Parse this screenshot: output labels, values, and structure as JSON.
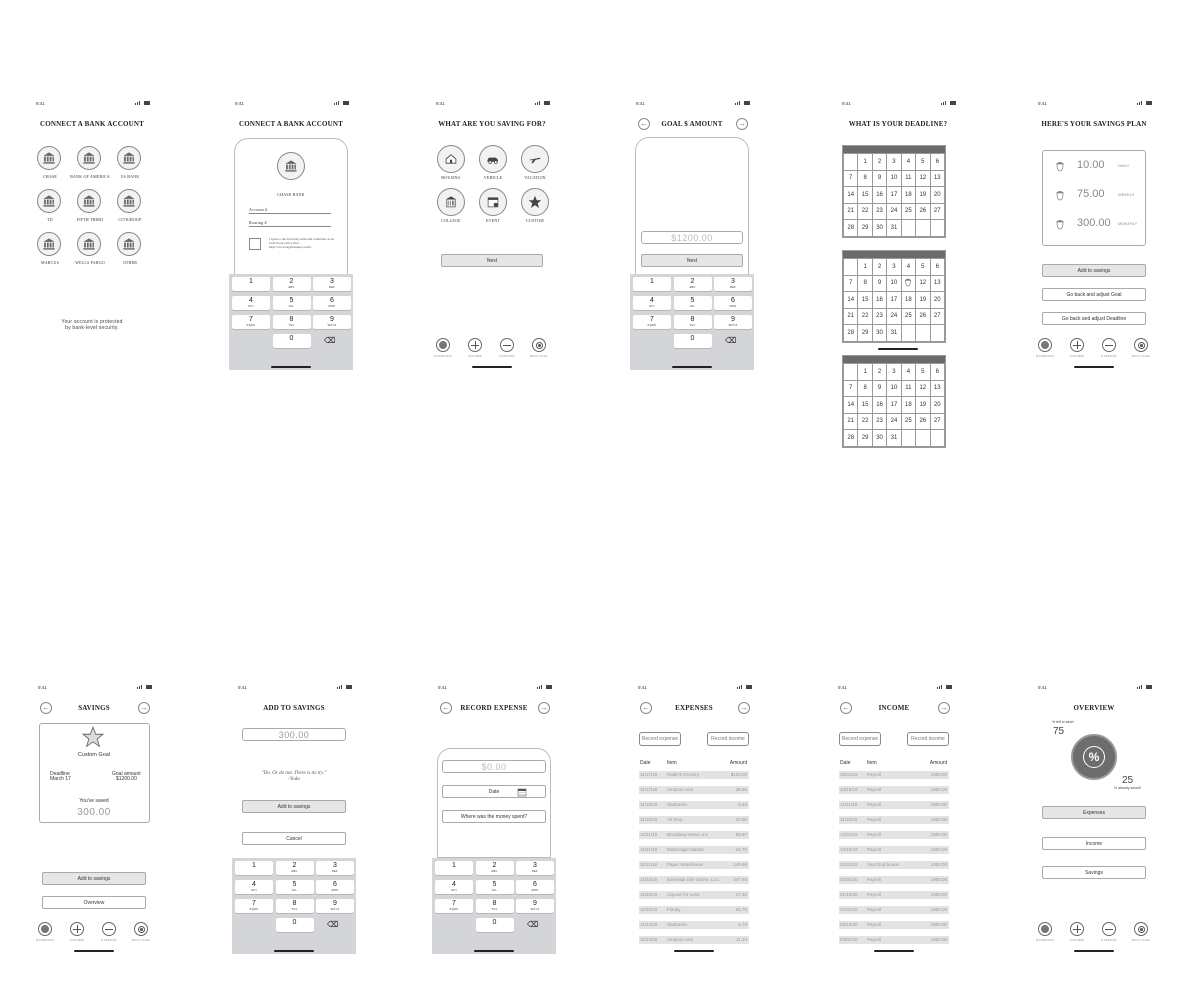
{
  "status_time": "9:41",
  "tabs": [
    "OVERVIEW",
    "INCOME",
    "EXPENSE",
    "NEW GOAL"
  ],
  "screen1": {
    "title": "CONNECT A BANK ACCOUNT",
    "banks": [
      "CHASE",
      "BANK OF AMERICA",
      "US BANK",
      "TD",
      "FIFTH THIRD",
      "CITIGROUP",
      "MARCUS",
      "WELLS FARGO",
      "OTHER"
    ],
    "security_line1": "Your account is protected",
    "security_line2": "by bank-level security."
  },
  "screen2": {
    "title": "CONNECT A BANK ACCOUNT",
    "bank": "CHASE BANK",
    "account_label": "Account #",
    "routing_label": "Routing #",
    "terms": "I agree to the following terms and conditions as set forth in our policy here: https://www.sugarmonkey.com/tc"
  },
  "keypad": [
    {
      "n": "1",
      "l": ""
    },
    {
      "n": "2",
      "l": "ABC"
    },
    {
      "n": "3",
      "l": "DEF"
    },
    {
      "n": "4",
      "l": "GHI"
    },
    {
      "n": "5",
      "l": "JKL"
    },
    {
      "n": "6",
      "l": "MNO"
    },
    {
      "n": "7",
      "l": "PQRS"
    },
    {
      "n": "8",
      "l": "TUV"
    },
    {
      "n": "9",
      "l": "WXYZ"
    },
    {
      "n": "0",
      "l": ""
    }
  ],
  "screen3": {
    "title": "WHAT ARE YOU SAVING FOR?",
    "categories": [
      "HOUSING",
      "VEHICLE",
      "VACATION",
      "COLLEGE",
      "EVENT",
      "CUSTOM"
    ],
    "next": "Next"
  },
  "screen4": {
    "title": "GOAL $ AMOUNT",
    "amount": "$1200.00",
    "next": "Next"
  },
  "screen5": {
    "title": "WHAT IS YOUR DEADLINE?",
    "rows": [
      [
        "",
        "1",
        "2",
        "3",
        "4",
        "5",
        "6"
      ],
      [
        "7",
        "8",
        "9",
        "10",
        "11",
        "12",
        "13"
      ],
      [
        "14",
        "15",
        "16",
        "17",
        "18",
        "19",
        "20"
      ],
      [
        "21",
        "22",
        "23",
        "24",
        "25",
        "26",
        "27"
      ],
      [
        "28",
        "29",
        "30",
        "31",
        "",
        "",
        ""
      ]
    ]
  },
  "screen6": {
    "title": "HERE'S YOUR SAVINGS PLAN",
    "plan": [
      {
        "amount": "10.00",
        "period": "DAILY"
      },
      {
        "amount": "75.00",
        "period": "WEEKLY"
      },
      {
        "amount": "300.00",
        "period": "MONTHLY"
      }
    ],
    "add": "Add to savings",
    "adjust_goal": "Go back and adjust Goal",
    "adjust_deadline": "Go back and adjust Deadline"
  },
  "screen7": {
    "title": "SAVINGS",
    "goal_name": "Custom Goal",
    "deadline_label": "Deadline",
    "deadline_value": "March 17",
    "goal_label": "Goal amount",
    "goal_value": "$1200.00",
    "saved_label": "You've saved",
    "saved_value": "300.00",
    "add": "Add to savings",
    "overview": "Overview"
  },
  "screen8": {
    "title": "ADD TO SAVINGS",
    "amount": "300.00",
    "quote": "\"Do. Or do not. There is no try.\"",
    "author": "-Yoda",
    "add": "Add to savings",
    "cancel": "Cancel"
  },
  "screen9": {
    "title": "RECORD EXPENSE",
    "amount": "$0.00",
    "date": "Date",
    "where": "Where was the money spent?"
  },
  "screen10": {
    "title": "EXPENSES",
    "record_expense": "Record expense",
    "record_income": "Record income",
    "headers": [
      "Date",
      "Item",
      "Amount"
    ],
    "rows": [
      [
        "11/17/19",
        "Ralph's Grocery",
        "$120.00"
      ],
      [
        "11/17/19",
        "Amazon.com",
        "36.65"
      ],
      [
        "11/18/19",
        "Starbucks",
        "5.48"
      ],
      [
        "11/18/19",
        "76 Stop",
        "22.90"
      ],
      [
        "11/21/19",
        "Broadway News, Inc",
        "59.87"
      ],
      [
        "11/21/19",
        "Mississippi Market",
        "44.75"
      ],
      [
        "11/21/19",
        "Paper Warehouse",
        "149.99"
      ],
      [
        "11/22/19",
        "Essential Oils Online, LLC",
        "347.65"
      ],
      [
        "11/23/19",
        "Liquour for Less",
        "17.32"
      ],
      [
        "11/23/19",
        "Floraly",
        "55.75"
      ],
      [
        "11/24/19",
        "Starbucks",
        "6.76"
      ],
      [
        "11/24/19",
        "Amazon.com",
        "11.34"
      ]
    ]
  },
  "screen11": {
    "title": "INCOME",
    "record_expense": "Record expense",
    "record_income": "Record income",
    "headers": [
      "Date",
      "Item",
      "Amount"
    ],
    "rows": [
      [
        "10/01/19",
        "Payroll",
        "1900.00"
      ],
      [
        "10/15/19",
        "Payroll",
        "1900.00"
      ],
      [
        "11/01/19",
        "Payroll",
        "1900.00"
      ],
      [
        "11/15/19",
        "Payroll",
        "1900.00"
      ],
      [
        "12/01/19",
        "Payroll",
        "1900.00"
      ],
      [
        "12/15/19",
        "Payroll",
        "1900.00"
      ],
      [
        "12/31/19",
        "Year End bonus",
        "1000.00"
      ],
      [
        "01/01/20",
        "Payroll",
        "1900.00"
      ],
      [
        "01/15/20",
        "Payroll",
        "1900.00"
      ],
      [
        "01/31/20",
        "Payroll",
        "1900.00"
      ],
      [
        "02/15/20",
        "Payroll",
        "1900.00"
      ],
      [
        "03/01/20",
        "Payroll",
        "1900.00"
      ]
    ]
  },
  "screen12": {
    "title": "OVERVIEW",
    "left_caption": "% left to save!",
    "left_value": "75",
    "saved_value": "25",
    "saved_caption": "% already saved!",
    "expenses": "Expenses",
    "income": "Income",
    "savings": "Savings"
  }
}
